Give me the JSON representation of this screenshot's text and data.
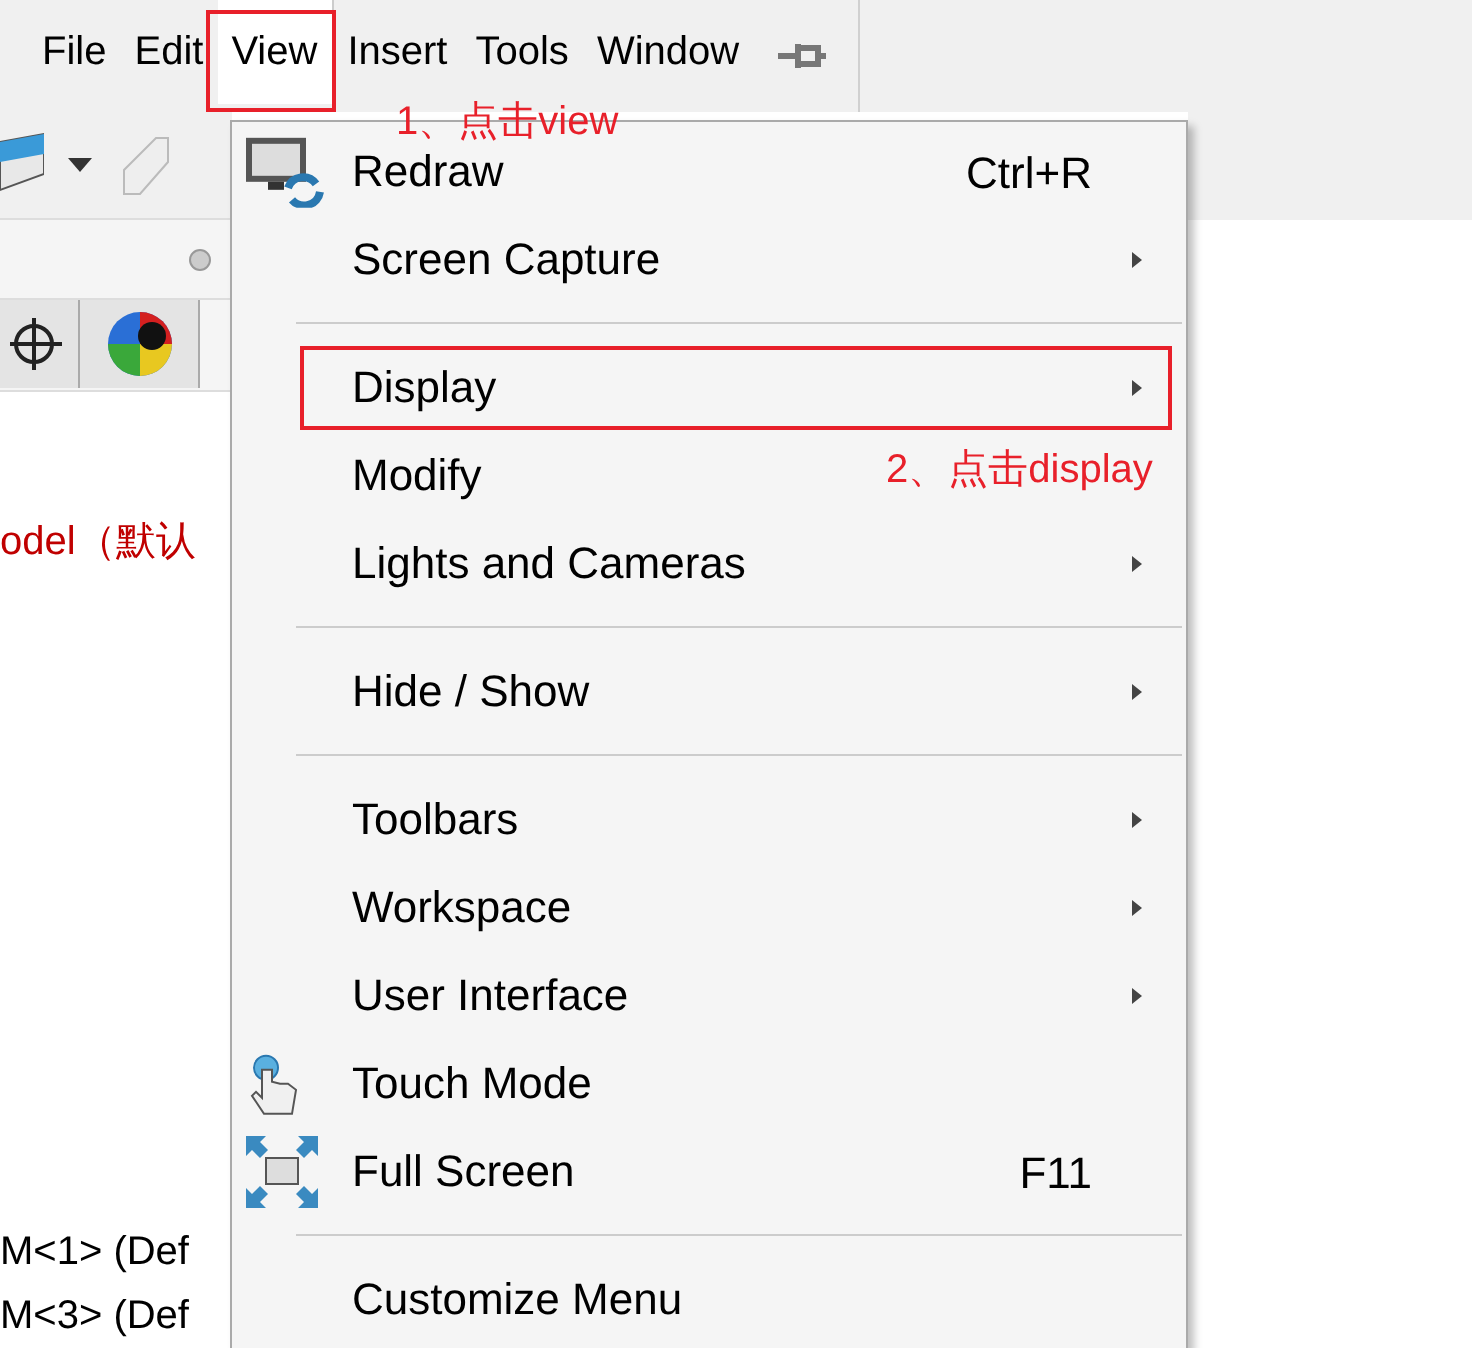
{
  "menubar": [
    {
      "label": "File",
      "selected": false
    },
    {
      "label": "Edit",
      "selected": false
    },
    {
      "label": "View",
      "selected": true,
      "annotated": true,
      "note": "1、点击view"
    },
    {
      "label": "Insert",
      "selected": false
    },
    {
      "label": "Tools",
      "selected": false
    },
    {
      "label": "Window",
      "selected": false
    }
  ],
  "tree": [
    {
      "label": "odel（默认",
      "kind": "root"
    },
    {
      "label": "M<1> (Def",
      "kind": "component"
    },
    {
      "label": "M<3> (Def",
      "kind": "component"
    }
  ],
  "menu": [
    {
      "kind": "item",
      "label": "Redraw",
      "shortcut": "Ctrl+R"
    },
    {
      "kind": "item",
      "label": "Screen Capture",
      "submenu": true
    },
    {
      "kind": "separator"
    },
    {
      "kind": "item",
      "label": "Display",
      "submenu": true,
      "annotated": true
    },
    {
      "kind": "item",
      "label": "Modify",
      "note": "2、点击display"
    },
    {
      "kind": "item",
      "label": "Lights and Cameras",
      "submenu": true
    },
    {
      "kind": "separator"
    },
    {
      "kind": "item",
      "label": "Hide / Show",
      "submenu": true
    },
    {
      "kind": "separator"
    },
    {
      "kind": "item",
      "label": "Toolbars",
      "submenu": true
    },
    {
      "kind": "item",
      "label": "Workspace",
      "submenu": true
    },
    {
      "kind": "item",
      "label": "User Interface",
      "submenu": true
    },
    {
      "kind": "item",
      "label": "Touch Mode"
    },
    {
      "kind": "item",
      "label": "Full Screen",
      "shortcut": "F11"
    },
    {
      "kind": "separator"
    },
    {
      "kind": "item",
      "label": "Customize Menu"
    }
  ]
}
